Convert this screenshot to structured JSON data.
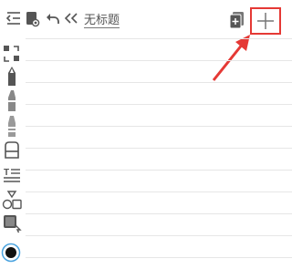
{
  "document": {
    "title": "无标题"
  },
  "colors": {
    "icon": "#555555",
    "highlight": "#e53935",
    "arrow": "#e53935",
    "ruled_line": "#e6e6e6",
    "current_color_ring": "#4aa3df",
    "current_color_fill": "#111111"
  },
  "toolbar": {
    "left_icons": [
      "menu-icon",
      "notebook-preview-icon",
      "undo-icon",
      "collapse-double-chevron-icon"
    ],
    "right_icons": [
      "new-page-icon",
      "add-icon"
    ]
  },
  "tools": [
    "lasso-select-icon",
    "pen-icon",
    "marker-icon",
    "highlighter-icon",
    "eraser-icon",
    "text-tool-icon",
    "shapes-icon",
    "image-insert-icon",
    "current-color-icon"
  ]
}
